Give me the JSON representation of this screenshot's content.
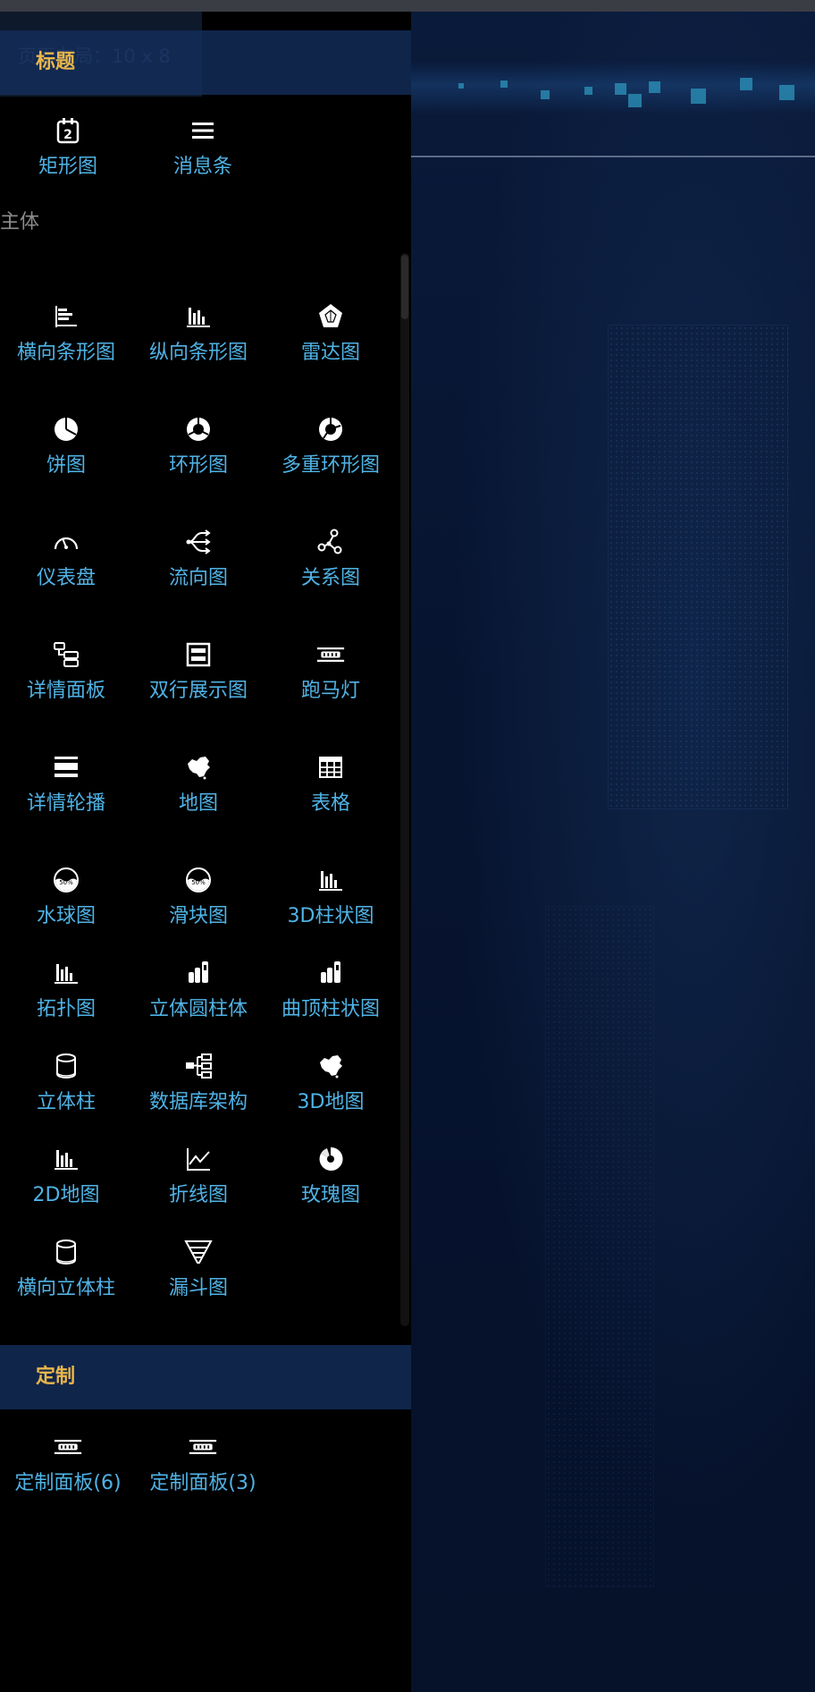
{
  "canvas_bg_label": "页面布局：10 x 8",
  "sections": {
    "title": "标题",
    "main": "主体",
    "custom": "定制"
  },
  "title_items": [
    {
      "label": "矩形图",
      "icon": "calendar-2-icon"
    },
    {
      "label": "消息条",
      "icon": "menu-lines-icon"
    }
  ],
  "main_items": [
    {
      "label": "横向条形图",
      "icon": "horizontal-bar-chart-icon"
    },
    {
      "label": "纵向条形图",
      "icon": "vertical-bar-chart-icon"
    },
    {
      "label": "雷达图",
      "icon": "radar-chart-icon"
    },
    {
      "label": "饼图",
      "icon": "pie-chart-icon"
    },
    {
      "label": "环形图",
      "icon": "donut-chart-icon"
    },
    {
      "label": "多重环形图",
      "icon": "multi-donut-chart-icon"
    },
    {
      "label": "仪表盘",
      "icon": "gauge-icon"
    },
    {
      "label": "流向图",
      "icon": "flow-icon"
    },
    {
      "label": "关系图",
      "icon": "relation-graph-icon"
    },
    {
      "label": "详情面板",
      "icon": "detail-panel-icon"
    },
    {
      "label": "双行展示图",
      "icon": "two-row-display-icon"
    },
    {
      "label": "跑马灯",
      "icon": "marquee-icon"
    },
    {
      "label": "详情轮播",
      "icon": "detail-carousel-icon"
    },
    {
      "label": "地图",
      "icon": "china-map-icon"
    },
    {
      "label": "表格",
      "icon": "table-icon"
    },
    {
      "label": "水球图",
      "icon": "liquid-ball-icon"
    },
    {
      "label": "滑块图",
      "icon": "slider-ball-icon"
    },
    {
      "label": "3D柱状图",
      "icon": "bar-3d-icon"
    },
    {
      "label": "拓扑图",
      "icon": "topology-bars-icon"
    },
    {
      "label": "立体圆柱体",
      "icon": "cylinder-bars-icon"
    },
    {
      "label": "曲顶柱状图",
      "icon": "curved-top-bars-icon"
    },
    {
      "label": "立体柱",
      "icon": "cylinder-icon"
    },
    {
      "label": "数据库架构",
      "icon": "database-tree-icon"
    },
    {
      "label": "3D地图",
      "icon": "china-map-3d-icon"
    },
    {
      "label": "2D地图",
      "icon": "bars-2d-map-icon"
    },
    {
      "label": "折线图",
      "icon": "line-chart-icon"
    },
    {
      "label": "玫瑰图",
      "icon": "rose-chart-icon"
    },
    {
      "label": "横向立体柱",
      "icon": "horizontal-cylinder-icon"
    },
    {
      "label": "漏斗图",
      "icon": "funnel-icon"
    }
  ],
  "custom_items": [
    {
      "label": "定制面板(6)",
      "icon": "custom-panel-icon"
    },
    {
      "label": "定制面板(3)",
      "icon": "custom-panel-icon"
    }
  ],
  "colors": {
    "section_title": "#e9b64a",
    "item_label": "#4fb3e6",
    "section_bg": "#142d5a",
    "sidebar_bg": "#000000",
    "canvas_bg": "#071430"
  }
}
